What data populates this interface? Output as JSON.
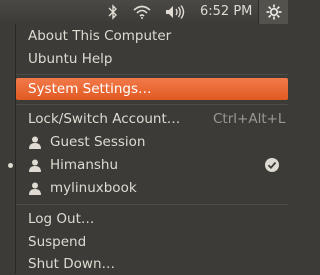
{
  "panel": {
    "time": "6:52 PM",
    "icons": [
      "bluetooth-icon",
      "wifi-icon",
      "volume-icon",
      "gear-icon"
    ]
  },
  "menu": {
    "about": "About This Computer",
    "help": "Ubuntu Help",
    "settings": "System Settings…",
    "lock": "Lock/Switch Account…",
    "lock_shortcut": "Ctrl+Alt+L",
    "users": [
      {
        "name": "Guest Session",
        "active": false
      },
      {
        "name": "Himanshu",
        "active": true
      },
      {
        "name": "mylinuxbook",
        "active": false
      }
    ],
    "logout": "Log Out…",
    "suspend": "Suspend",
    "shutdown": "Shut Down…"
  },
  "colors": {
    "highlight": "#e9672f",
    "panel_bg": "#3c3b37",
    "text": "#dfdbd2"
  }
}
